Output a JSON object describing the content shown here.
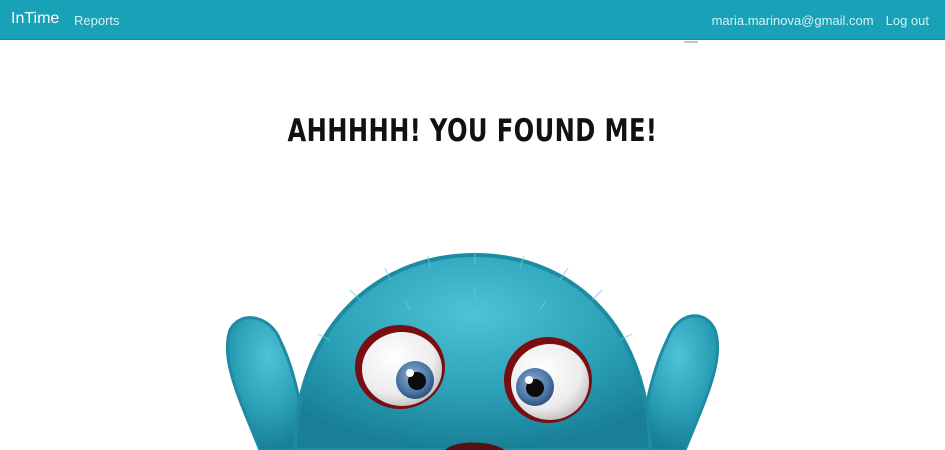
{
  "navbar": {
    "brand": "InTime",
    "links": [
      "Reports"
    ],
    "user_email": "maria.marinova@gmail.com",
    "logout_label": "Log out",
    "color": "#17a2b8"
  },
  "main": {
    "headline": "AHHHHH! YOU FOUND ME!",
    "illustration_icon": "blue-furry-monster-icon"
  }
}
